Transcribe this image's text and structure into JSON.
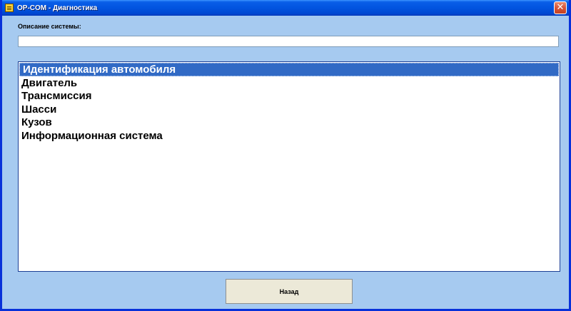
{
  "window": {
    "title": "OP-COM - Диагностика",
    "close_glyph": "✕"
  },
  "system_description": {
    "label": "Описание системы:",
    "value": ""
  },
  "systems_list": {
    "selected_index": 0,
    "items": [
      {
        "label": "Идентификация автомобиля"
      },
      {
        "label": "Двигатель"
      },
      {
        "label": "Трансмиссия"
      },
      {
        "label": "Шасси"
      },
      {
        "label": "Кузов"
      },
      {
        "label": "Информационная система"
      }
    ]
  },
  "footer": {
    "back_label": "Назад"
  },
  "colors": {
    "window_bg": "#a6caf0",
    "titlebar": "#0254e0",
    "selection": "#316ac5",
    "button_face": "#ece9d8"
  },
  "icons": {
    "app": "app-icon",
    "close": "close-icon"
  }
}
